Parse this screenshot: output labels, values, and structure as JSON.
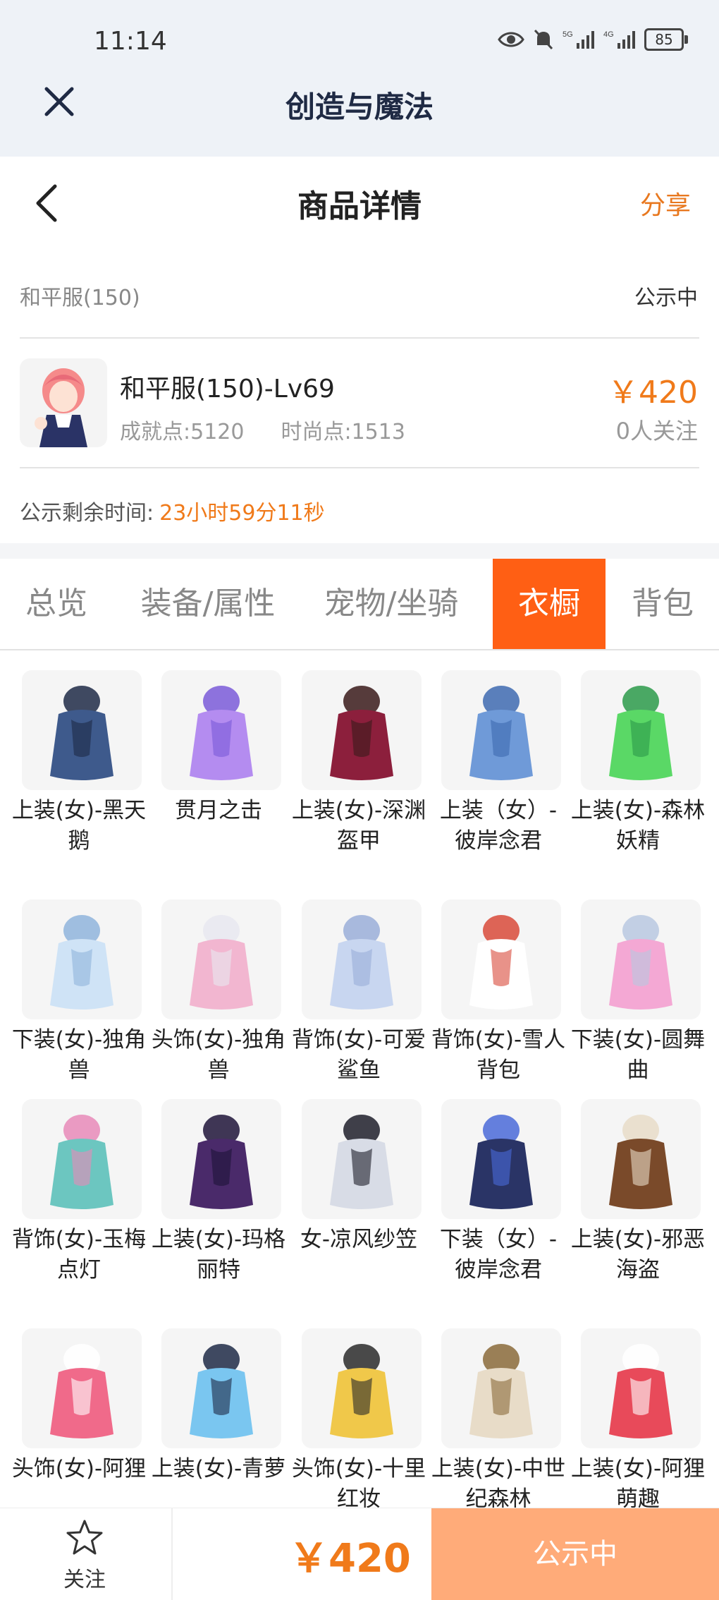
{
  "status_bar": {
    "time": "11:14",
    "battery": "85"
  },
  "app": {
    "title": "创造与魔法"
  },
  "header": {
    "title": "商品详情",
    "share": "分享"
  },
  "listing": {
    "category": "和平服(150)",
    "status": "公示中",
    "name": "和平服(150)-Lv69",
    "achievement": "成就点:5120",
    "fashion": "时尚点:1513",
    "price": "￥420",
    "followers": "0人关注",
    "remaining_label": "公示剩余时间:",
    "remaining_value": "23小时59分11秒"
  },
  "tabs": [
    {
      "label": "总览",
      "active": false
    },
    {
      "label": "装备/属性",
      "active": false
    },
    {
      "label": "宠物/坐骑",
      "active": false
    },
    {
      "label": "衣橱",
      "active": true
    },
    {
      "label": "背包",
      "active": false
    }
  ],
  "wardrobe": [
    {
      "label": "上装(女)-黑天鹅",
      "icon": "black-swan-dress-icon"
    },
    {
      "label": "贯月之击",
      "icon": "purple-wing-weapon-icon"
    },
    {
      "label": "上装(女)-深渊盔甲",
      "icon": "abyss-armor-icon"
    },
    {
      "label": "上装（女）-彼岸念君",
      "icon": "blue-gown-icon"
    },
    {
      "label": "上装(女)-森林妖精",
      "icon": "forest-fairy-dress-icon"
    },
    {
      "label": "下装(女)-独角兽",
      "icon": "unicorn-shoes-icon"
    },
    {
      "label": "头饰(女)-独角兽",
      "icon": "unicorn-hood-icon"
    },
    {
      "label": "背饰(女)-可爱鲨鱼",
      "icon": "shark-backpack-icon"
    },
    {
      "label": "背饰(女)-雪人背包",
      "icon": "snowman-backpack-icon"
    },
    {
      "label": "下装(女)-圆舞曲",
      "icon": "pink-heels-icon"
    },
    {
      "label": "背饰(女)-玉梅点灯",
      "icon": "jade-lantern-icon"
    },
    {
      "label": "上装(女)-玛格丽特",
      "icon": "dark-purple-dress-icon"
    },
    {
      "label": "女-凉风纱笠",
      "icon": "veil-hat-icon"
    },
    {
      "label": "下装（女）-彼岸念君",
      "icon": "navy-stockings-icon"
    },
    {
      "label": "上装(女)-邪恶海盗",
      "icon": "pirate-outfit-icon"
    },
    {
      "label": "头饰(女)-阿狸",
      "icon": "ahri-fox-head-icon"
    },
    {
      "label": "上装(女)-青萝",
      "icon": "blue-kimono-icon"
    },
    {
      "label": "头饰(女)-十里红妆",
      "icon": "golden-crown-icon"
    },
    {
      "label": "上装(女)-中世纪森林",
      "icon": "medieval-dress-icon"
    },
    {
      "label": "上装(女)-阿狸萌趣",
      "icon": "fox-hoodie-icon"
    }
  ],
  "bottom_bar": {
    "follow": "关注",
    "price": "￥420",
    "action": "公示中"
  }
}
